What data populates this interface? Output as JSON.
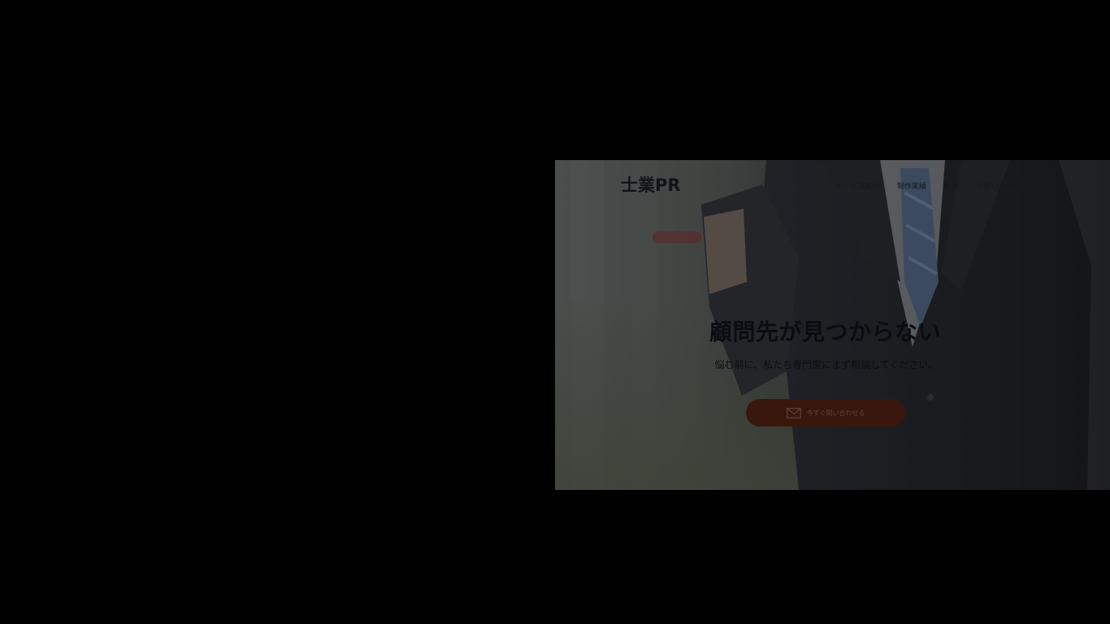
{
  "site": {
    "logo": "士業PR"
  },
  "nav": {
    "items": [
      {
        "label": "サービス案内"
      },
      {
        "label": "制作実績"
      },
      {
        "label": "料金"
      },
      {
        "label": "お問い合わせ"
      }
    ]
  },
  "hero": {
    "title": "顧問先が見つからない",
    "subtitle": "悩む前に、私たち専門家にまず相談してください。",
    "cta_label": "今すぐ問い合わせる",
    "cta_icon": "mail-icon",
    "cta_color": "#3a170c"
  },
  "colors": {
    "overlay_bg": "#000000",
    "text_dark": "#121419"
  }
}
